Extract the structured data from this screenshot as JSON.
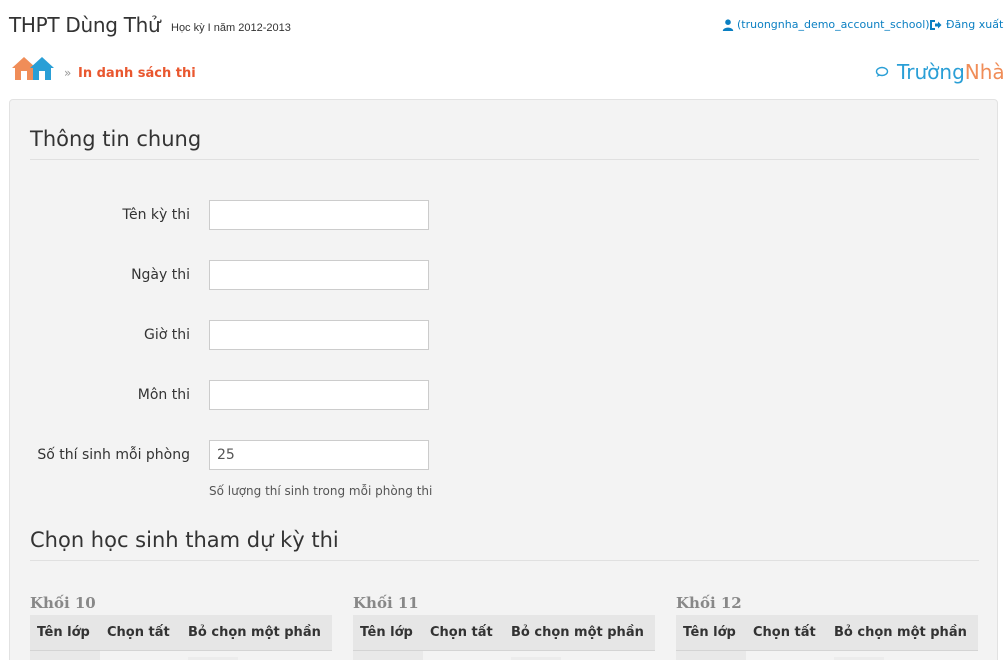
{
  "header": {
    "school_name": "THPT Dùng Thử",
    "term": "Học kỳ I năm 2012-2013",
    "user_link": "(truongnha_demo_account_school)",
    "logout": "Đăng xuất"
  },
  "breadcrumb": {
    "separator": "»",
    "current": "In danh sách thi"
  },
  "brand": {
    "part1": "Trường",
    "part2": "Nhà"
  },
  "general": {
    "title": "Thông tin chung",
    "fields": [
      {
        "label": "Tên kỳ thi",
        "value": ""
      },
      {
        "label": "Ngày thi",
        "value": ""
      },
      {
        "label": "Giờ thi",
        "value": ""
      },
      {
        "label": "Môn thi",
        "value": ""
      },
      {
        "label": "Số thí sinh mỗi phòng",
        "value": "25"
      }
    ],
    "help": "Số lượng thí sinh trong mỗi phòng thi"
  },
  "students": {
    "title": "Chọn học sinh tham dự kỳ thi",
    "grades": [
      {
        "name": "Khối 10"
      },
      {
        "name": "Khối 11"
      },
      {
        "name": "Khối 12"
      }
    ],
    "columns": [
      "Tên lớp",
      "Chọn tất",
      "Bỏ chọn một phần"
    ]
  },
  "colors": {
    "accent": "#e9572f",
    "link": "#0a7fc2",
    "brand_blue": "#2a9fd6",
    "brand_orange": "#f08d58"
  },
  "icons": [
    "user-icon",
    "logout-icon",
    "home-icon",
    "chat-icon"
  ]
}
